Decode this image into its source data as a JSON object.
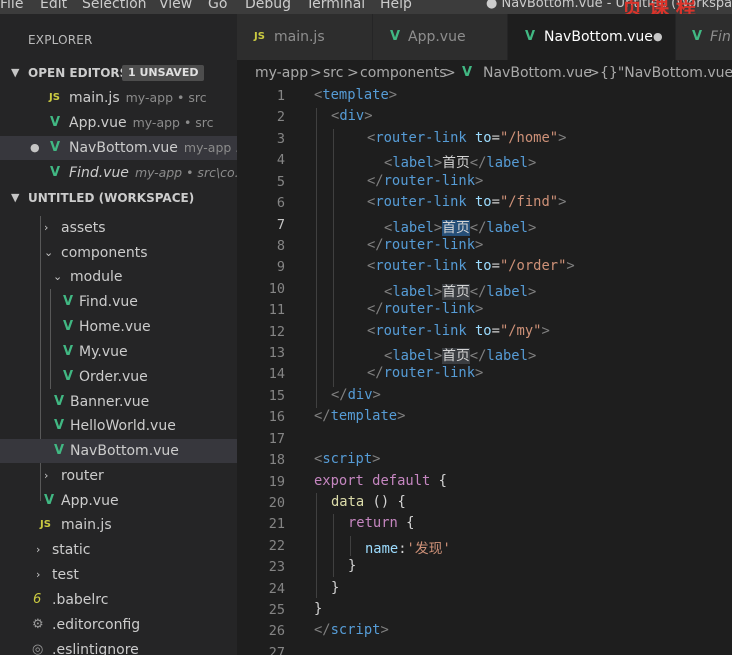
{
  "menubar": {
    "items": [
      "File",
      "Edit",
      "Selection",
      "View",
      "Go",
      "Debug",
      "Terminal",
      "Help"
    ],
    "window_title": "● NavBottom.vue - Untitled (Workspace)",
    "watermark": "页 课 程"
  },
  "sidebar": {
    "title": "EXPLORER",
    "open_editors": {
      "label": "OPEN EDITORS",
      "badge": "1 UNSAVED",
      "items": [
        {
          "icon": "js-icon",
          "name": "main.js",
          "path": "my-app • src"
        },
        {
          "icon": "vue-icon",
          "name": "App.vue",
          "path": "my-app • src"
        },
        {
          "icon": "vue-icon",
          "name": "NavBottom.vue",
          "path": "my-app ..."
        },
        {
          "icon": "vue-icon",
          "name": "Find.vue",
          "path": "my-app • src\\co..."
        }
      ]
    },
    "workspace": {
      "label": "UNTITLED (WORKSPACE)",
      "tree": [
        {
          "name": "assets"
        },
        {
          "name": "components"
        },
        {
          "name": "module"
        },
        {
          "name": "Find.vue"
        },
        {
          "name": "Home.vue"
        },
        {
          "name": "My.vue"
        },
        {
          "name": "Order.vue"
        },
        {
          "name": "Banner.vue"
        },
        {
          "name": "HelloWorld.vue"
        },
        {
          "name": "NavBottom.vue"
        },
        {
          "name": "router"
        },
        {
          "name": "App.vue"
        },
        {
          "name": "main.js"
        },
        {
          "name": "static"
        },
        {
          "name": "test"
        },
        {
          "name": ".babelrc"
        },
        {
          "name": ".editorconfig"
        },
        {
          "name": ".eslintignore"
        }
      ]
    }
  },
  "tabs": [
    {
      "icon": "JS",
      "label": "main.js"
    },
    {
      "icon": "V",
      "label": "App.vue"
    },
    {
      "icon": "V",
      "label": "NavBottom.vue"
    },
    {
      "icon": "V",
      "label": "Fin"
    }
  ],
  "breadcrumb": {
    "parts": [
      "my-app",
      "src",
      "components",
      "NavBottom.vue",
      "{}\"NavBottom.vue\""
    ],
    "sep": ">"
  },
  "editor": {
    "line_numbers": [
      "1",
      "2",
      "3",
      "4",
      "5",
      "6",
      "7",
      "8",
      "9",
      "10",
      "11",
      "12",
      "13",
      "14",
      "15",
      "16",
      "17",
      "18",
      "19",
      "20",
      "21",
      "22",
      "23",
      "24",
      "25",
      "26",
      "27"
    ],
    "current_line": "7",
    "code": {
      "tag_template": "template",
      "tag_div": "div",
      "tag_router_link": "router-link",
      "tag_label": "label",
      "attr_to": "to",
      "route_home": "\"/home\"",
      "route_find": "\"/find\"",
      "route_order": "\"/order\"",
      "route_my": "\"/my\"",
      "label_text": "首页",
      "tag_script": "script",
      "kw_export": "export",
      "kw_default": "default",
      "kw_return": "return",
      "fn_data": "data",
      "prop_name": "name",
      "str_faxian": "'发现'"
    }
  },
  "colors": {
    "editor_bg": "#1e1e1e",
    "sidebar_bg": "#252526",
    "tag": "#569cd6",
    "attribute": "#9cdcfe",
    "string": "#ce9178",
    "keyword": "#c586c0",
    "vue_icon": "#41b883",
    "js_icon": "#cbcb41"
  }
}
